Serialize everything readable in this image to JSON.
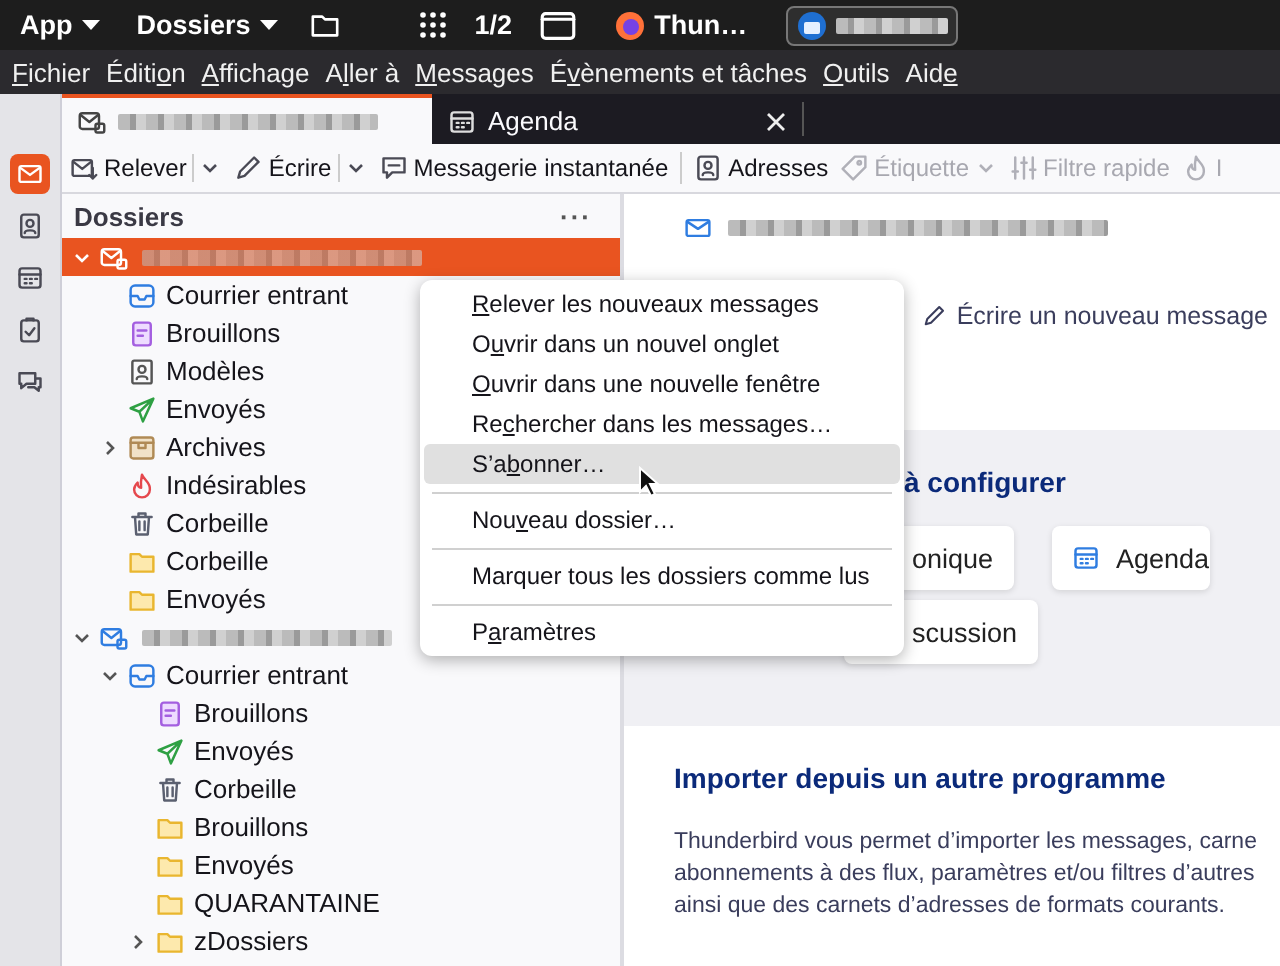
{
  "top_bar": {
    "app_menu": "App",
    "places_menu": "Dossiers",
    "workspace": "1/2",
    "taskbar": [
      {
        "kind": "browser",
        "label": "Thun…",
        "selected": false
      },
      {
        "kind": "mail",
        "selected": true
      }
    ]
  },
  "menu_bar": [
    {
      "key": "F",
      "after": "ichier"
    },
    {
      "before": "Éditi",
      "key": "o",
      "after": "n"
    },
    {
      "key": "A",
      "after": "ffichage"
    },
    {
      "before": "A",
      "key": "l",
      "after": "ler à"
    },
    {
      "key": "M",
      "after": "essages"
    },
    {
      "before": "É",
      "key": "v",
      "after": "ènements et tâches"
    },
    {
      "key": "O",
      "after": "utils"
    },
    {
      "before": "Aid",
      "key": "e"
    }
  ],
  "spaces": [
    {
      "kind": "mail",
      "selected": true
    },
    {
      "kind": "contacts",
      "selected": false
    },
    {
      "kind": "calendar",
      "selected": false
    },
    {
      "kind": "tasks",
      "selected": false
    },
    {
      "kind": "chat",
      "selected": false
    }
  ],
  "tabs": [
    {
      "kind": "mail",
      "selected": true,
      "closable": false
    },
    {
      "kind": "calendar",
      "label": "Agenda",
      "selected": false,
      "closable": true
    }
  ],
  "toolbar": [
    {
      "kind": "get",
      "label": "Relever",
      "dropdown": true,
      "split": true,
      "disabled": false
    },
    {
      "kind": "write",
      "label": "Écrire",
      "dropdown": true,
      "split": true,
      "disabled": false
    },
    {
      "kind": "chat",
      "label": "Messagerie instantanée",
      "disabled": false
    },
    {
      "kind": "separator"
    },
    {
      "kind": "address",
      "label": "Adresses",
      "disabled": false
    },
    {
      "kind": "tag",
      "label": "Étiquette",
      "dropdown": true,
      "split": false,
      "disabled": true
    },
    {
      "kind": "filter",
      "label": "Filtre rapide",
      "disabled": true
    },
    {
      "kind": "junk",
      "label": "I",
      "disabled": true
    }
  ],
  "folder_pane": {
    "title": "Dossiers",
    "more": "···",
    "tree": [
      {
        "kind": "account",
        "selected": true,
        "expanded": true,
        "children": [
          {
            "kind": "inbox",
            "label": "Courrier entrant",
            "selected": false
          },
          {
            "kind": "drafts",
            "label": "Brouillons",
            "selected": false
          },
          {
            "kind": "templates",
            "label": "Modèles",
            "selected": false
          },
          {
            "kind": "sent",
            "label": "Envoyés",
            "selected": false
          },
          {
            "kind": "archive",
            "label": "Archives",
            "selected": false,
            "expanded": false
          },
          {
            "kind": "junk",
            "label": "Indésirables",
            "selected": false
          },
          {
            "kind": "trash",
            "label": "Corbeille",
            "selected": false
          },
          {
            "kind": "folder",
            "label": "Corbeille",
            "selected": false
          },
          {
            "kind": "folder",
            "label": "Envoyés",
            "selected": false
          }
        ]
      },
      {
        "kind": "account",
        "selected": false,
        "expanded": true,
        "children": [
          {
            "kind": "inbox",
            "label": "Courrier entrant",
            "selected": false,
            "expanded": true,
            "children": [
              {
                "kind": "drafts",
                "label": "Brouillons",
                "selected": false
              },
              {
                "kind": "sent",
                "label": "Envoyés",
                "selected": false
              },
              {
                "kind": "trash",
                "label": "Corbeille",
                "selected": false
              },
              {
                "kind": "folder",
                "label": "Brouillons",
                "selected": false
              },
              {
                "kind": "folder",
                "label": "Envoyés",
                "selected": false
              },
              {
                "kind": "folder",
                "label": "QUARANTAINE",
                "selected": false
              },
              {
                "kind": "folder",
                "label": "zDossiers",
                "selected": false,
                "expanded": false
              }
            ]
          }
        ]
      }
    ]
  },
  "context_menu": {
    "items": [
      {
        "kind": "item",
        "key": "R",
        "after": "elever les nouveaux messages",
        "selected": false
      },
      {
        "kind": "item",
        "before": "O",
        "key": "u",
        "after": "vrir dans un nouvel onglet",
        "selected": false
      },
      {
        "kind": "item",
        "key": "O",
        "after": "uvrir dans une nouvelle fenêtre",
        "selected": false
      },
      {
        "kind": "item",
        "before": "Re",
        "key": "c",
        "after": "hercher dans les messages…",
        "selected": false
      },
      {
        "kind": "item",
        "before": "S’a",
        "key": "b",
        "after": "onner…",
        "selected": true
      },
      {
        "kind": "separator"
      },
      {
        "kind": "item",
        "before": "Nou",
        "key": "v",
        "after": "eau dossier…",
        "selected": false
      },
      {
        "kind": "separator"
      },
      {
        "kind": "item",
        "before": "Marquer tous les dossiers comme lus",
        "selected": false
      },
      {
        "kind": "separator"
      },
      {
        "kind": "item",
        "before": "P",
        "key": "a",
        "after": "ramètres",
        "selected": false
      }
    ]
  },
  "content": {
    "compose_link": "Écrire un nouveau message",
    "setup_heading": "à configurer",
    "setup_cards": [
      {
        "kind": "plain",
        "label": "onique"
      },
      {
        "kind": "calendar",
        "label": "Agenda"
      },
      {
        "kind": "plain",
        "label": "scussion"
      }
    ],
    "import_heading": "Importer depuis un autre programme",
    "import_lines": [
      "Thunderbird vous permet d’importer les messages, carne",
      "abonnements à des flux, paramètres et/ou filtres d’autres",
      "ainsi que des carnets d’adresses de formats courants."
    ]
  }
}
